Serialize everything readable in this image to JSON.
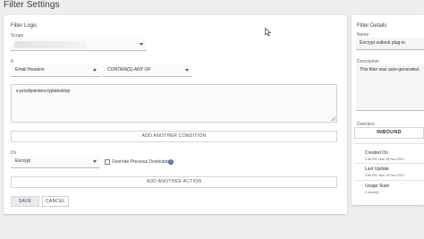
{
  "page": {
    "title": "Filter Settings"
  },
  "filter_logic": {
    "section_title": "Filter Logic",
    "scope_label": "Scope",
    "scope_value": "",
    "if_label": "If",
    "condition_field": "Email Headers",
    "condition_operator": "CONTAIN(S) ANY OF",
    "condition_value": "x-proofpointencryptdesktop",
    "add_condition_label": "ADD ANOTHER CONDITION",
    "do_label": "Do",
    "action_value": "Encrypt",
    "override_label": "Override Previous Destination",
    "override_checked": false,
    "info_icon_glyph": "i",
    "add_action_label": "ADD ANOTHER ACTION",
    "save_label": "SAVE",
    "cancel_label": "CANCEL"
  },
  "filter_details": {
    "section_title": "Filter Details",
    "name_label": "Name",
    "name_value": "Encrypt outlook plug-in",
    "description_label": "Description",
    "description_value": "This filter was auto-generated.",
    "direction_label": "Direction",
    "direction_value": "INBOUND",
    "created_on_title": "Created On",
    "created_on_value": "3:56 PM, Mon 18 Nov 2019",
    "last_update_title": "Last Update",
    "last_update_value": "3:56 PM, Mon 18 Nov 2019",
    "usage_stats_title": "Usage Stats",
    "usage_stats_value": "0 email(s)"
  },
  "icons": {
    "scope_dropdown": "chevron-down-icon",
    "field_dropdown": "chevron-down-icon",
    "operator_dropdown": "chevron-down-icon",
    "action_dropdown": "chevron-down-icon",
    "info": "info-icon",
    "cursor": "mouse-pointer-icon"
  },
  "colors": {
    "background": "#eeeeef",
    "card": "#ffffff",
    "info_icon": "#4a6ea8",
    "save_button": "#e8eaf0"
  }
}
